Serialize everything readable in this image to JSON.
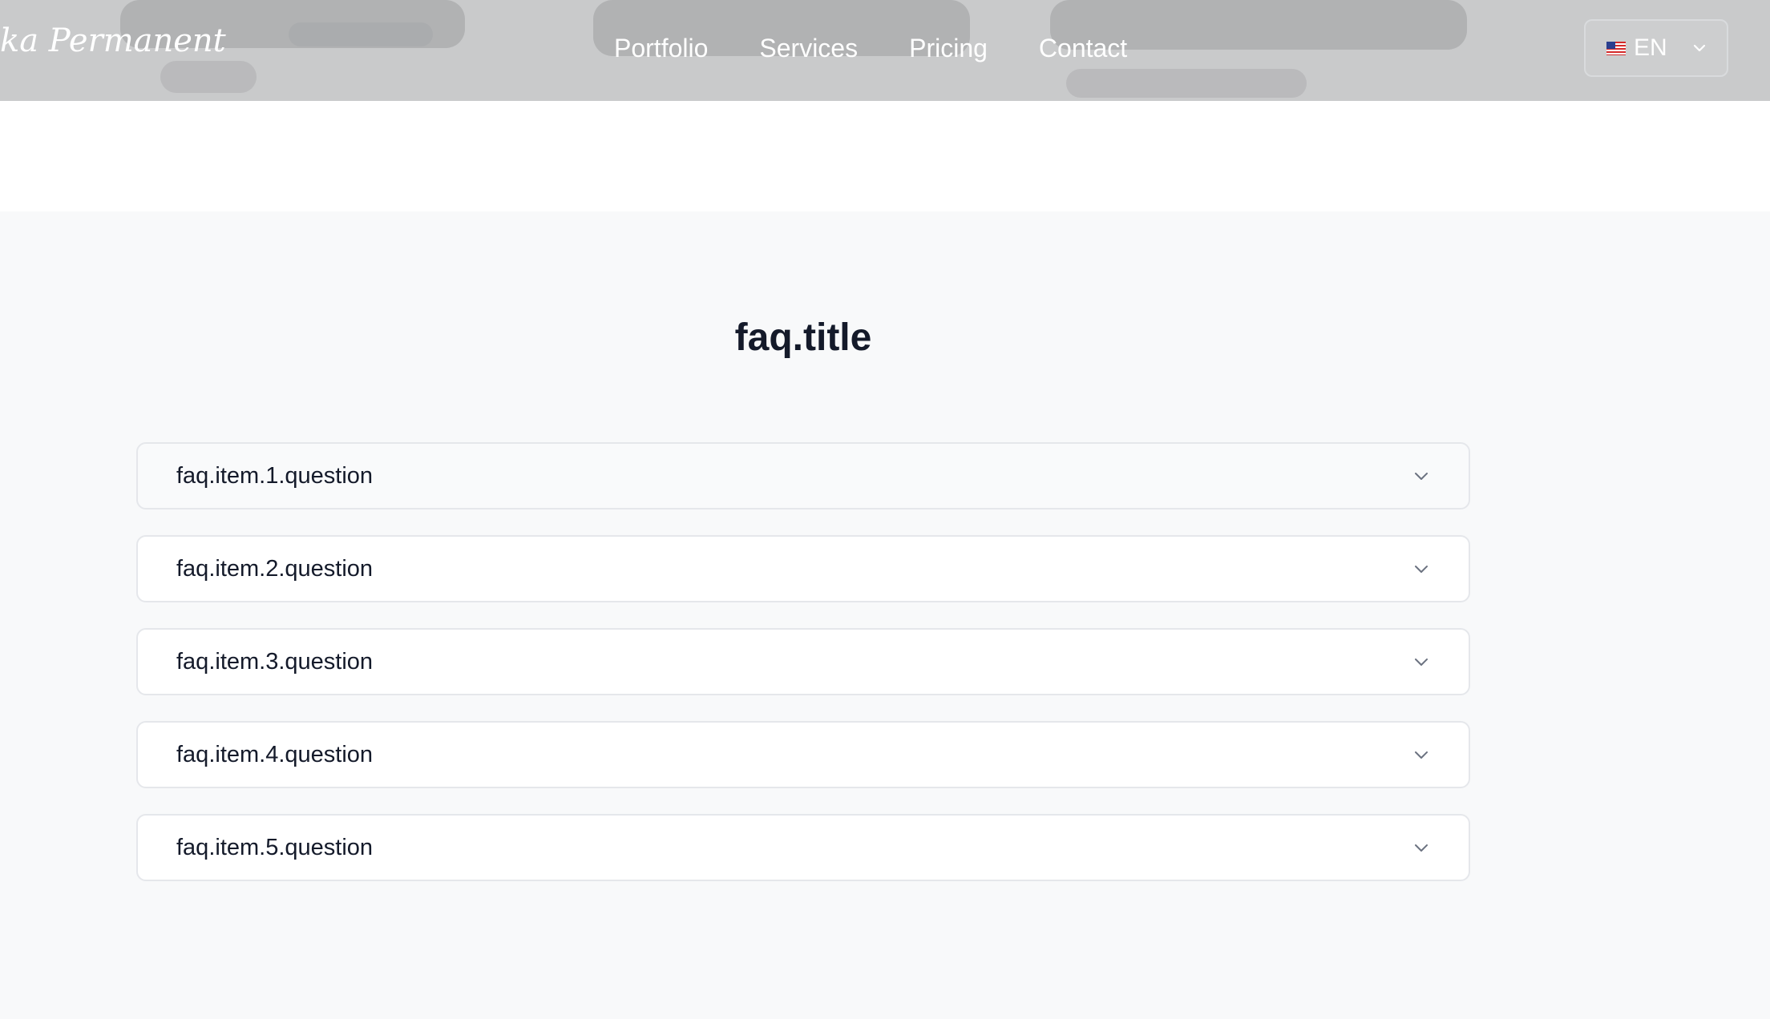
{
  "header": {
    "logo_text": "ka Permanent",
    "nav": [
      {
        "label": "Portfolio"
      },
      {
        "label": "Services"
      },
      {
        "label": "Pricing"
      },
      {
        "label": "Contact"
      }
    ],
    "language": {
      "label": "EN",
      "flag_icon": "us-flag-icon"
    }
  },
  "faq": {
    "title": "faq.title",
    "items": [
      {
        "question": "faq.item.1.question"
      },
      {
        "question": "faq.item.2.question"
      },
      {
        "question": "faq.item.3.question"
      },
      {
        "question": "faq.item.4.question"
      },
      {
        "question": "faq.item.5.question"
      }
    ]
  },
  "colors": {
    "header_bg": "#c9cacb",
    "section_bg": "#f8f9fa",
    "title_text": "#141a2a",
    "item_border": "#e5e7eb"
  }
}
